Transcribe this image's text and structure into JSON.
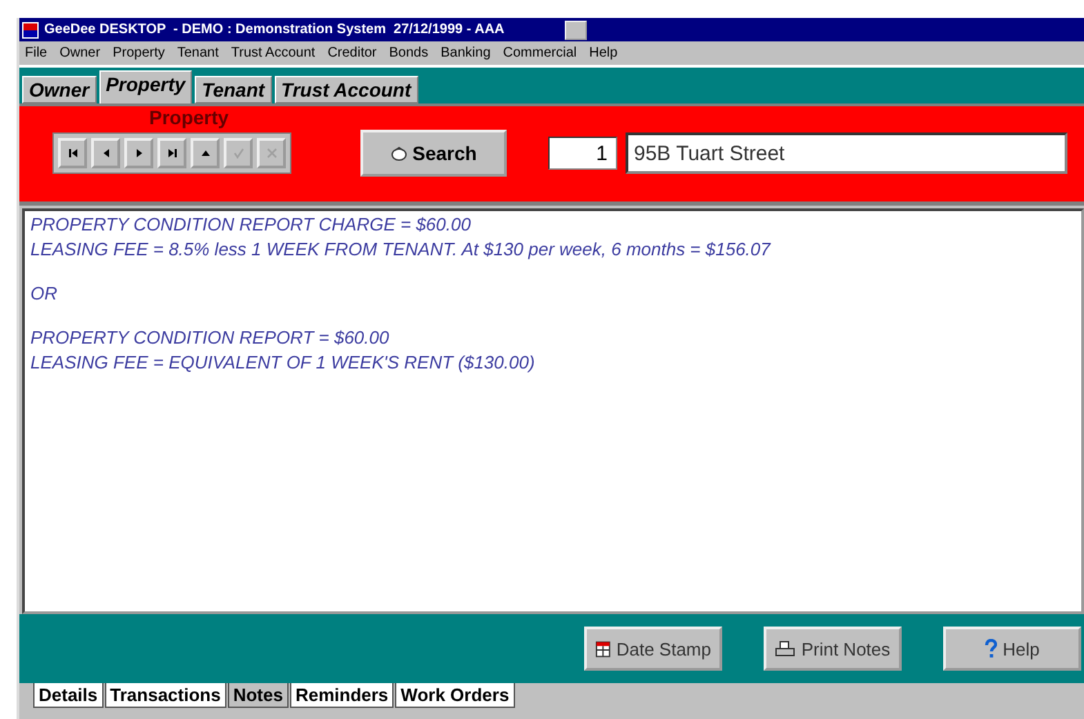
{
  "window": {
    "title": "GeeDee DESKTOP  - DEMO : Demonstration System  27/12/1999 - AAA"
  },
  "menu": [
    "File",
    "Owner",
    "Property",
    "Tenant",
    "Trust Account",
    "Creditor",
    "Bonds",
    "Banking",
    "Commercial",
    "Help"
  ],
  "tabs": [
    {
      "label": "Owner",
      "selected": false
    },
    {
      "label": "Property",
      "selected": true
    },
    {
      "label": "Tenant",
      "selected": false
    },
    {
      "label": "Trust Account",
      "selected": false
    }
  ],
  "toolbar": {
    "section_label": "Property",
    "nav_buttons": [
      {
        "kind": "first",
        "disabled": false
      },
      {
        "kind": "prev",
        "disabled": false
      },
      {
        "kind": "next",
        "disabled": false
      },
      {
        "kind": "last",
        "disabled": false
      },
      {
        "kind": "up",
        "disabled": false
      },
      {
        "kind": "check",
        "disabled": true
      },
      {
        "kind": "cancel",
        "disabled": true
      }
    ],
    "search_button": "Search",
    "record_number": "1",
    "address": "95B Tuart Street"
  },
  "notes": [
    [
      "PROPERTY CONDITION REPORT CHARGE = $60.00",
      "LEASING FEE = 8.5% less 1 WEEK FROM TENANT. At $130 per week, 6 months = $156.07"
    ],
    [
      "OR"
    ],
    [
      "PROPERTY CONDITION REPORT = $60.00",
      "LEASING FEE = EQUIVALENT OF 1 WEEK'S RENT ($130.00)"
    ]
  ],
  "actions": [
    {
      "kind": "date",
      "label": "Date Stamp"
    },
    {
      "kind": "print",
      "label": "Print Notes"
    },
    {
      "kind": "help",
      "label": "Help"
    }
  ],
  "bottom_tabs": [
    {
      "label": "Details",
      "selected": false
    },
    {
      "label": "Transactions",
      "selected": false
    },
    {
      "label": "Notes",
      "selected": true
    },
    {
      "label": "Reminders",
      "selected": false
    },
    {
      "label": "Work Orders",
      "selected": false
    }
  ]
}
